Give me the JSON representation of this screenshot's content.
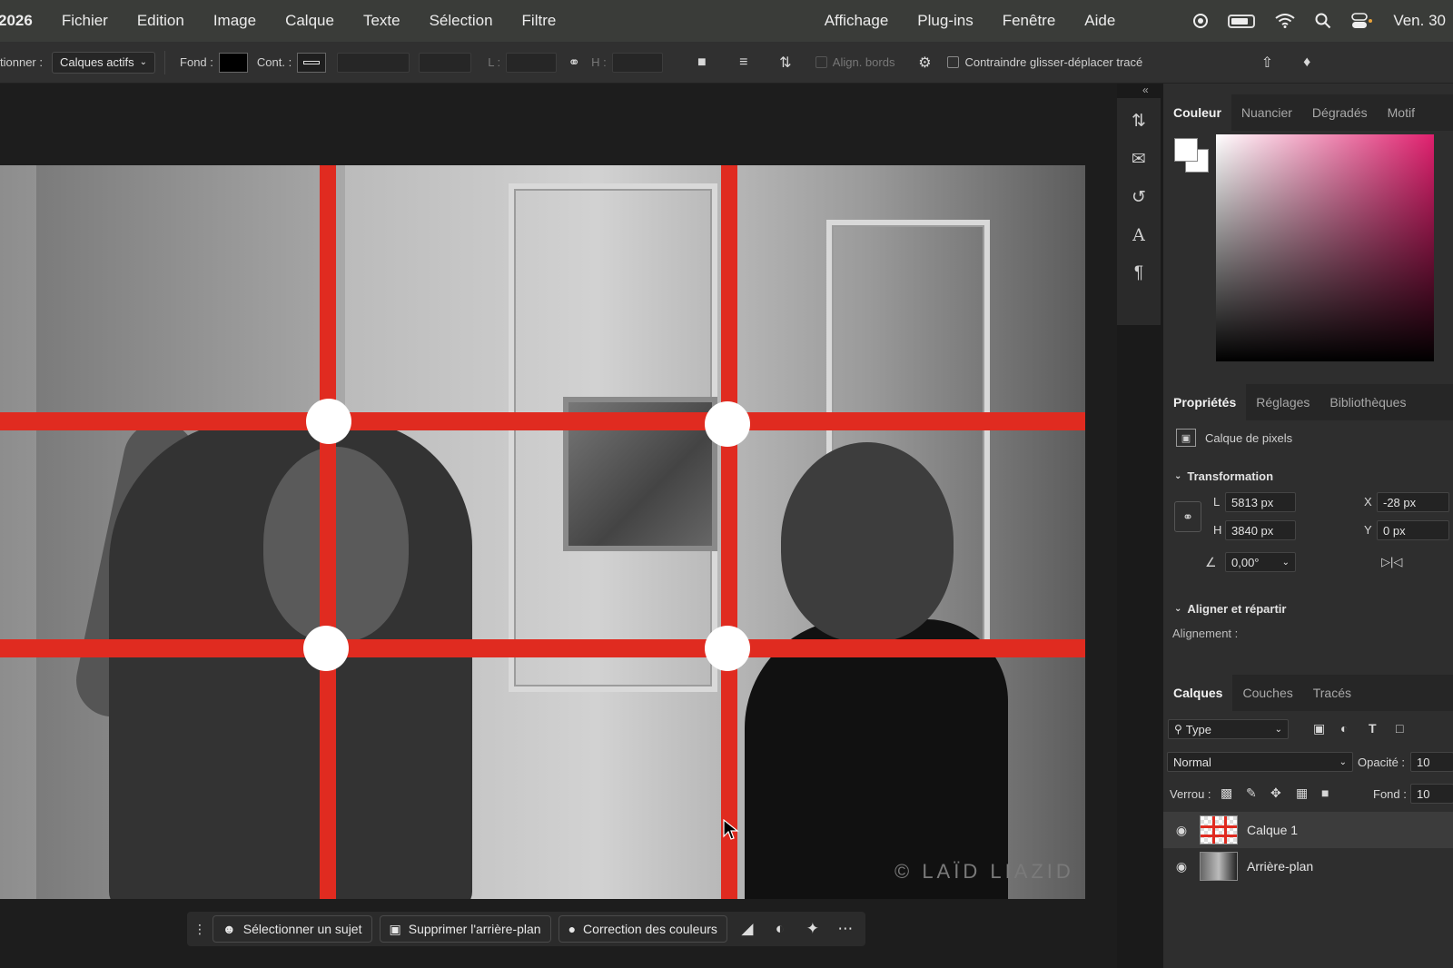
{
  "menubar": {
    "app_name": "2026",
    "items": [
      "Fichier",
      "Edition",
      "Image",
      "Calque",
      "Texte",
      "Sélection",
      "Filtre"
    ],
    "items_right": [
      "Affichage",
      "Plug-ins",
      "Fenêtre",
      "Aide"
    ],
    "clock": "Ven. 30"
  },
  "options": {
    "select_label": "tionner :",
    "select_value": "Calques actifs",
    "fill_label": "Fond :",
    "fill_color": "#000000",
    "stroke_label": "Cont. :",
    "width_label": "L :",
    "height_label": "H :",
    "align_edges": "Align. bords",
    "constrain_label": "Contraindre glisser-déplacer tracé"
  },
  "canvas": {
    "watermark": "© LAÏD LIAZID",
    "grid_color": "#e02b20"
  },
  "taskbar": {
    "select_subject": "Sélectionner un sujet",
    "remove_bg": "Supprimer l'arrière-plan",
    "color_correction": "Correction des couleurs"
  },
  "color_panel": {
    "tabs": [
      "Couleur",
      "Nuancier",
      "Dégradés",
      "Motif"
    ],
    "hue_color": "#e0206e"
  },
  "properties": {
    "tabs": [
      "Propriétés",
      "Réglages",
      "Bibliothèques"
    ],
    "layer_kind": "Calque de pixels",
    "transformation": "Transformation",
    "w_label": "L",
    "w_value": "5813 px",
    "h_label": "H",
    "h_value": "3840 px",
    "x_label": "X",
    "x_value": "-28 px",
    "y_label": "Y",
    "y_value": "0 px",
    "angle_value": "0,00°",
    "align_section": "Aligner et répartir",
    "alignment_label": "Alignement :"
  },
  "layers": {
    "tabs": [
      "Calques",
      "Couches",
      "Tracés"
    ],
    "filter": "Type",
    "blend_mode": "Normal",
    "opacity_label": "Opacité :",
    "opacity_value": "10",
    "lock_label": "Verrou :",
    "fill_label": "Fond :",
    "fill_value": "10",
    "items": [
      {
        "name": "Calque 1",
        "selected": true
      },
      {
        "name": "Arrière-plan",
        "selected": false
      }
    ]
  }
}
